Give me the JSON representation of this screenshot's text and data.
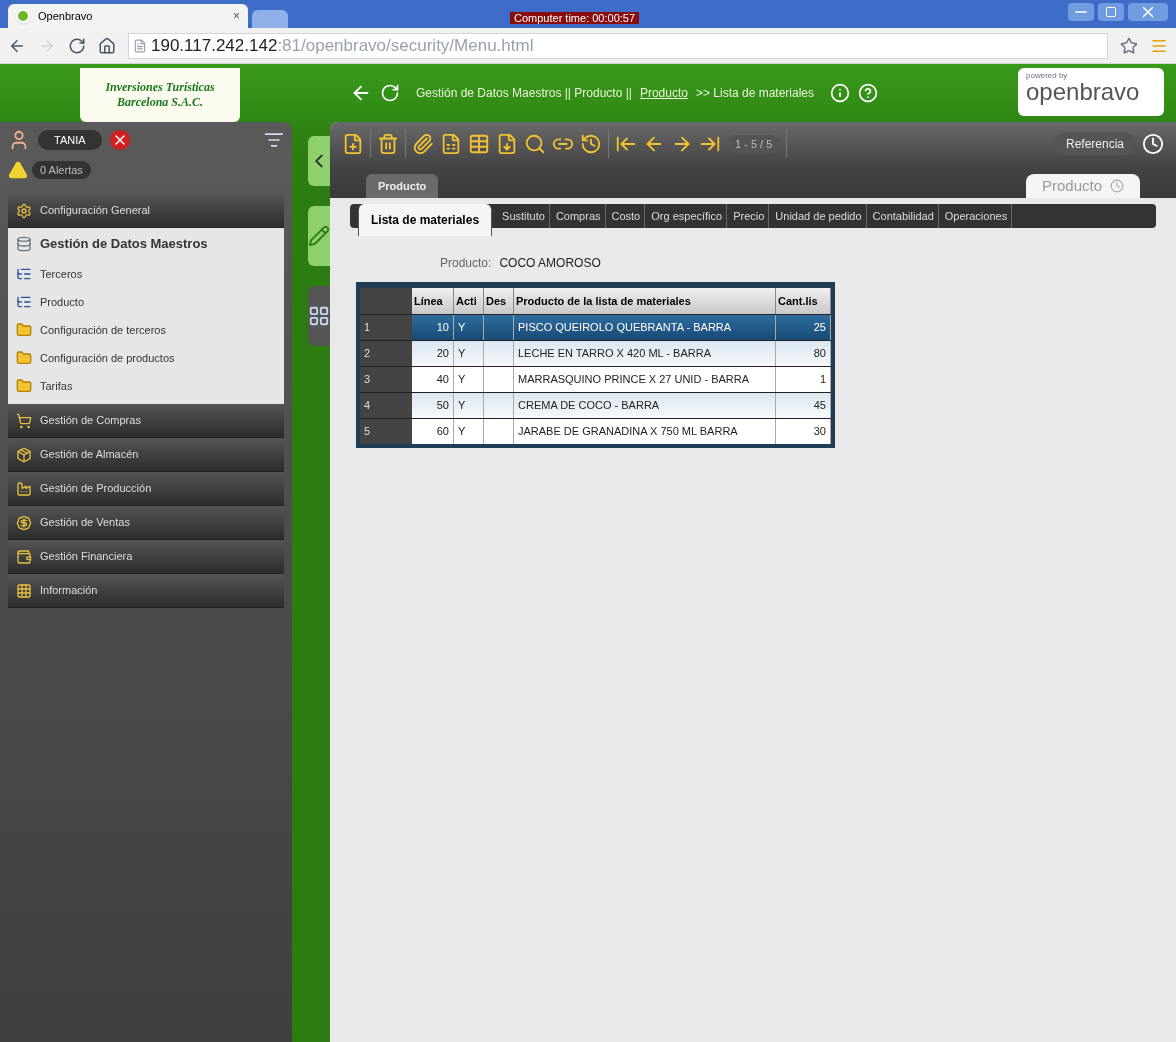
{
  "browser": {
    "tab_title": "Openbravo",
    "tab_close": "×",
    "computer_time": "Computer time: 00:00:57",
    "url_host": "190.117.242.142",
    "url_rest": ":81/openbravo/security/Menu.html"
  },
  "header": {
    "company": [
      "Inversiones Turísticas",
      "Barcelona S.A.C."
    ],
    "breadcrumb_path": "Gestión de Datos Maestros || Producto ||",
    "breadcrumb_link": "Producto",
    "breadcrumb_current": ">> Lista de materiales",
    "powered_by": "powered by",
    "logo": "openbravo"
  },
  "sidebar": {
    "user": "TANIA",
    "alerts": "0 Alertas",
    "menu": [
      {
        "label": "Configuración General",
        "expanded": false
      },
      {
        "label": "Gestión de Datos Maestros",
        "expanded": true,
        "children": [
          {
            "label": "Terceros",
            "kind": "window"
          },
          {
            "label": "Producto",
            "kind": "window"
          },
          {
            "label": "Configuración de terceros",
            "kind": "folder"
          },
          {
            "label": "Configuración de productos",
            "kind": "folder"
          },
          {
            "label": "Tarifas",
            "kind": "folder"
          }
        ]
      },
      {
        "label": "Gestión de Compras",
        "expanded": false
      },
      {
        "label": "Gestión de Almacén",
        "expanded": false
      },
      {
        "label": "Gestión de Producción",
        "expanded": false
      },
      {
        "label": "Gestión de Ventas",
        "expanded": false
      },
      {
        "label": "Gestión Financiera",
        "expanded": false
      },
      {
        "label": "Información",
        "expanded": false
      }
    ]
  },
  "toolbar": {
    "record_count": "1 - 5 / 5",
    "reference": "Referencia"
  },
  "parent_tab": "Producto",
  "window_label": "Producto",
  "subtabs": [
    {
      "label": "Lista de materiales",
      "selected": true
    },
    {
      "label": "Sustituto",
      "selected": false
    },
    {
      "label": "Compras",
      "selected": false
    },
    {
      "label": "Costo",
      "selected": false
    },
    {
      "label": "Org específico",
      "selected": false
    },
    {
      "label": "Precio",
      "selected": false
    },
    {
      "label": "Unidad de pedido",
      "selected": false
    },
    {
      "label": "Contabilidad",
      "selected": false
    },
    {
      "label": "Operaciones",
      "selected": false
    }
  ],
  "form": {
    "label": "Producto:",
    "value": "COCO AMOROSO"
  },
  "table": {
    "columns": [
      "Línea",
      "Acti",
      "Des",
      "Producto de la lista de materiales",
      "Cant.lis"
    ],
    "rows": [
      {
        "number": "1",
        "cells": [
          "10",
          "Y",
          "",
          "PISCO QUEIROLO QUEBRANTA - BARRA",
          "25"
        ],
        "selected": true
      },
      {
        "number": "2",
        "cells": [
          "20",
          "Y",
          "",
          "LECHE EN TARRO X 420 ML - BARRA",
          "80"
        ],
        "selected": false
      },
      {
        "number": "3",
        "cells": [
          "40",
          "Y",
          "",
          "MARRASQUINO PRINCE X 27 UNID - BARRA",
          "1"
        ],
        "selected": false
      },
      {
        "number": "4",
        "cells": [
          "50",
          "Y",
          "",
          "CREMA DE COCO - BARRA",
          "45"
        ],
        "selected": false
      },
      {
        "number": "5",
        "cells": [
          "60",
          "Y",
          "",
          "JARABE DE GRANADINA X 750 ML BARRA",
          "30"
        ],
        "selected": false
      }
    ]
  }
}
